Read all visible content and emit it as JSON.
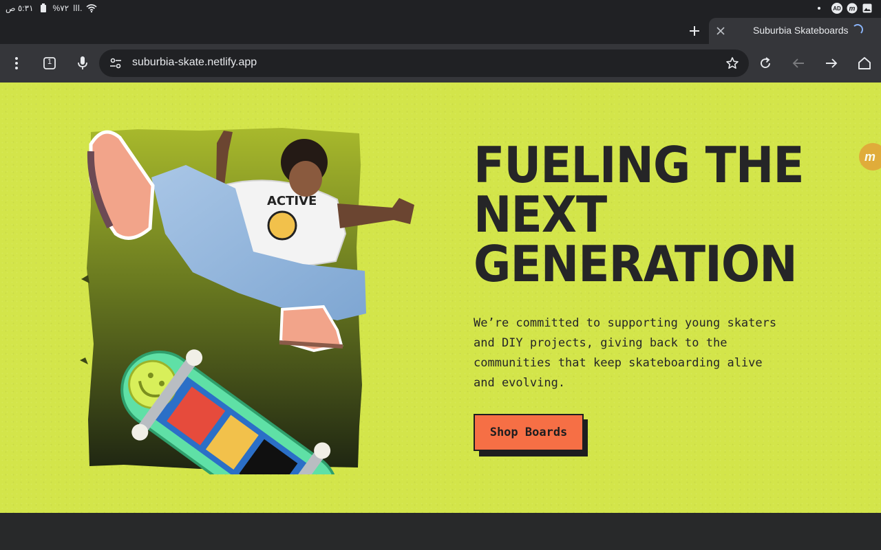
{
  "status_bar": {
    "time": "٥:٣١ ص",
    "battery": "%٧٢",
    "signal": "ااا.",
    "notification_badge": "AD"
  },
  "browser": {
    "tab_title": "Suburbia Skateboards",
    "url": "suburbia-skate.netlify.app",
    "tab_count": "1"
  },
  "hero": {
    "headline": [
      "FUELING THE",
      "NEXT",
      "GENERATION"
    ],
    "body": "We’re committed to supporting young skaters and DIY projects, giving back to the communities that keep skateboarding alive and evolving.",
    "cta_label": "Shop Boards",
    "floating_badge": "m",
    "image_alt": "Skater mid-air with skateboard",
    "colors": {
      "background": "#d3e54a",
      "text": "#252527",
      "cta": "#f66f45",
      "footer": "#28292a"
    }
  },
  "icons": [
    "wifi-icon",
    "battery-icon",
    "plus-icon",
    "close-icon",
    "menu-dots-icon",
    "tab-switcher-icon",
    "mic-icon",
    "site-settings-icon",
    "star-icon",
    "reload-icon",
    "back-icon",
    "forward-icon",
    "home-icon"
  ]
}
